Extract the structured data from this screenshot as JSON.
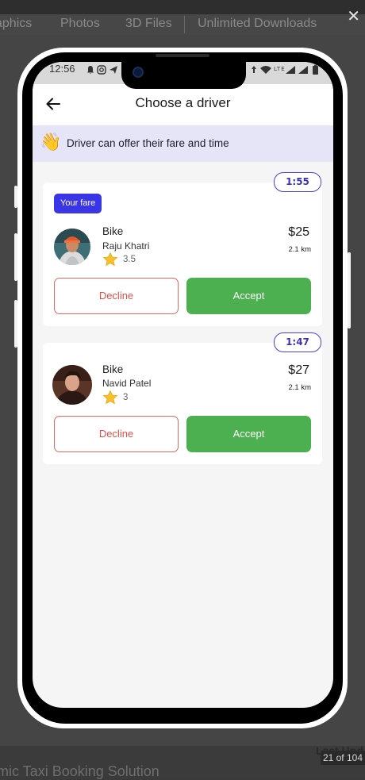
{
  "backdrop": {
    "categories": [
      "aphics",
      "Photos",
      "3D Files",
      "Unlimited Downloads"
    ],
    "close_symbol": "✕",
    "footer_title": "amic Taxi Booking Solution",
    "footer_last_updated": "Last Upd",
    "counter": "21 of 104"
  },
  "status_bar": {
    "time": "12:56",
    "left_icons": [
      "bell-icon",
      "instagram-icon",
      "send-icon"
    ],
    "right_icons": [
      "location-icon",
      "wifi-icon",
      "signal-icon",
      "battery-icon"
    ],
    "right_text": "LTE"
  },
  "header": {
    "title": "Choose a driver",
    "back_icon": "arrow-left-icon"
  },
  "banner": {
    "icon": "👋",
    "text": "Driver can offer their fare and time"
  },
  "offers": [
    {
      "timer": "1:55",
      "badge": "Your fare",
      "vehicle": "Bike",
      "driver_name": "Raju Khatri",
      "rating": "3.5",
      "price": "$25",
      "distance": "2.1 km",
      "decline_label": "Decline",
      "accept_label": "Accept"
    },
    {
      "timer": "1:47",
      "vehicle": "Bike",
      "driver_name": "Navid Patel",
      "rating": "3",
      "price": "$27",
      "distance": "2.1 km",
      "decline_label": "Decline",
      "accept_label": "Accept"
    }
  ],
  "colors": {
    "accent": "#3b35e8",
    "accept": "#4caf50",
    "decline": "#d9534a",
    "banner_bg": "#e6e4f7"
  }
}
